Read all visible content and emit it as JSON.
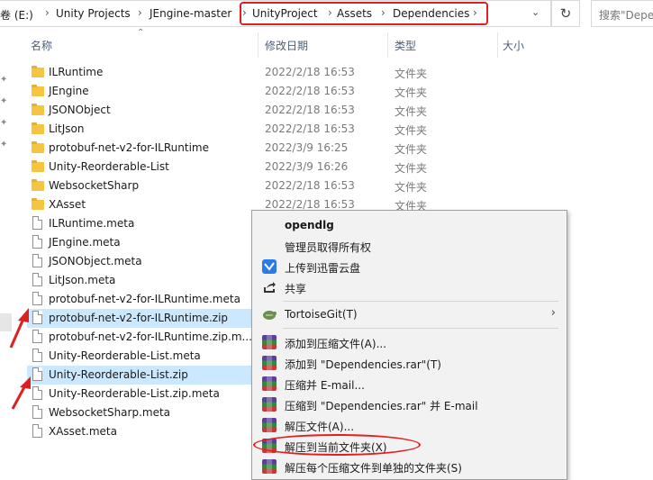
{
  "address_bar": {
    "segments": [
      "卷 (E:)",
      "Unity Projects",
      "JEngine-master",
      "UnityProject",
      "Assets",
      "Dependencies"
    ],
    "separator": "›"
  },
  "search": {
    "placeholder": "搜索\"Depe"
  },
  "columns": {
    "name": "名称",
    "modified": "修改日期",
    "type": "类型",
    "size": "大小"
  },
  "files": [
    {
      "name": "ILRuntime",
      "date": "2022/2/18 16:53",
      "type": "文件夹",
      "kind": "folder"
    },
    {
      "name": "JEngine",
      "date": "2022/2/18 16:53",
      "type": "文件夹",
      "kind": "folder"
    },
    {
      "name": "JSONObject",
      "date": "2022/2/18 16:53",
      "type": "文件夹",
      "kind": "folder"
    },
    {
      "name": "LitJson",
      "date": "2022/2/18 16:53",
      "type": "文件夹",
      "kind": "folder"
    },
    {
      "name": "protobuf-net-v2-for-ILRuntime",
      "date": "2022/3/9 16:25",
      "type": "文件夹",
      "kind": "folder"
    },
    {
      "name": "Unity-Reorderable-List",
      "date": "2022/3/9 16:26",
      "type": "文件夹",
      "kind": "folder"
    },
    {
      "name": "WebsocketSharp",
      "date": "2022/2/18 16:53",
      "type": "文件夹",
      "kind": "folder"
    },
    {
      "name": "XAsset",
      "date": "2022/2/18 16:53",
      "type": "文件夹",
      "kind": "folder"
    },
    {
      "name": "ILRuntime.meta",
      "kind": "file"
    },
    {
      "name": "JEngine.meta",
      "kind": "file"
    },
    {
      "name": "JSONObject.meta",
      "kind": "file"
    },
    {
      "name": "LitJson.meta",
      "kind": "file"
    },
    {
      "name": "protobuf-net-v2-for-ILRuntime.meta",
      "kind": "file"
    },
    {
      "name": "protobuf-net-v2-for-ILRuntime.zip",
      "kind": "file",
      "state": "selected"
    },
    {
      "name": "protobuf-net-v2-for-ILRuntime.zip.m...",
      "kind": "file"
    },
    {
      "name": "Unity-Reorderable-List.meta",
      "kind": "file"
    },
    {
      "name": "Unity-Reorderable-List.zip",
      "kind": "file",
      "state": "selected"
    },
    {
      "name": "Unity-Reorderable-List.zip.meta",
      "kind": "file"
    },
    {
      "name": "WebsocketSharp.meta",
      "kind": "file"
    },
    {
      "name": "XAsset.meta",
      "kind": "file"
    }
  ],
  "context_menu": {
    "items": [
      {
        "label": "opendlg",
        "icon": "none",
        "bold": true
      },
      {
        "label": "管理员取得所有权",
        "icon": "none"
      },
      {
        "label": "上传到迅雷云盘",
        "icon": "xunlei-icon"
      },
      {
        "label": "共享",
        "icon": "share-icon"
      },
      {
        "label": "TortoiseGit(T)",
        "icon": "tortoisegit-icon",
        "submenu": true
      },
      {
        "label": "添加到压缩文件(A)...",
        "icon": "winrar-icon"
      },
      {
        "label": "添加到 \"Dependencies.rar\"(T)",
        "icon": "winrar-icon"
      },
      {
        "label": "压缩并 E-mail...",
        "icon": "winrar-icon"
      },
      {
        "label": "压缩到 \"Dependencies.rar\" 并 E-mail",
        "icon": "winrar-icon"
      },
      {
        "label": "解压文件(A)...",
        "icon": "winrar-icon"
      },
      {
        "label": "解压到当前文件夹(X)",
        "icon": "winrar-icon",
        "highlighted": true
      },
      {
        "label": "解压每个压缩文件到单独的文件夹(S)",
        "icon": "winrar-icon"
      }
    ]
  },
  "colors": {
    "selection": "#cce8ff",
    "annotation": "#e02020",
    "folder": "#f5c542"
  }
}
